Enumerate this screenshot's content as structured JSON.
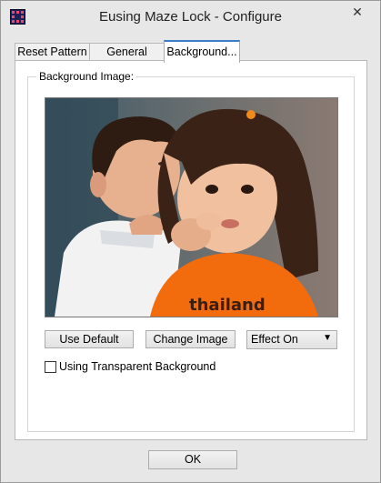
{
  "window": {
    "title": "Eusing Maze Lock - Configure",
    "close_glyph": "✕",
    "app_icon": "maze-app-icon"
  },
  "tabs": [
    {
      "label": "Reset Pattern",
      "active": false
    },
    {
      "label": "General",
      "active": false
    },
    {
      "label": "Background...",
      "active": true
    }
  ],
  "background": {
    "group_label": "Background Image:",
    "image_description_icon": "photo-two-kids",
    "use_default_label": "Use Default",
    "change_image_label": "Change Image",
    "effect_select": {
      "selected": "Effect On",
      "caret": "▼"
    },
    "transparent_checkbox": {
      "label": "Using Transparent Background",
      "checked": false
    }
  },
  "footer": {
    "ok_label": "OK"
  },
  "colors": {
    "tab_accent": "#3c7fc6",
    "window_bg": "#e7e7e7",
    "panel_bg": "#ffffff"
  }
}
